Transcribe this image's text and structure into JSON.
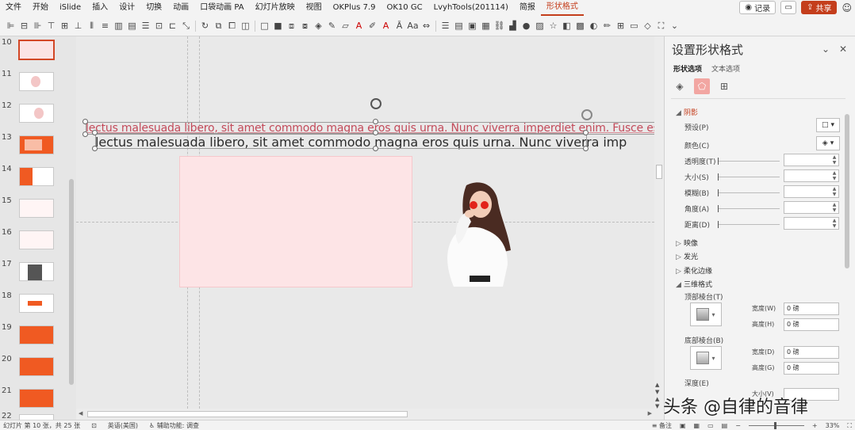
{
  "menubar": {
    "items": [
      "文件",
      "开始",
      "iSlide",
      "插入",
      "设计",
      "切换",
      "动画",
      "口袋动画 PA",
      "幻灯片放映",
      "视图",
      "OKPlus 7.9",
      "OK10 GC",
      "LvyhTools(201114)",
      "简报",
      "形状格式"
    ],
    "active": "形状格式",
    "record_label": "记录",
    "share_label": "共享"
  },
  "thumbnails": {
    "numbers": [
      "10",
      "11",
      "12",
      "13",
      "14",
      "15",
      "16",
      "17",
      "18",
      "19",
      "20",
      "21",
      "22"
    ],
    "selected": "10"
  },
  "slide": {
    "text_line1": "lectus malesuada libero, sit amet commodo magna eros quis urna. Nunc viverra imperdiet enim. Fusce est",
    "text_line2": "lectus malesuada libero, sit amet commodo magna eros quis urna. Nunc viverra imp"
  },
  "pane": {
    "title": "设置形状格式",
    "tabs": [
      "形状选项",
      "文本选项"
    ],
    "active_tab": "形状选项",
    "shadow_section": "阴影",
    "preset_label": "预设(P)",
    "color_label": "颜色(C)",
    "transparency_label": "透明度(T)",
    "size_label": "大小(S)",
    "blur_label": "模糊(B)",
    "angle_label": "角度(A)",
    "distance_label": "距离(D)",
    "reflection_section": "映像",
    "glow_section": "发光",
    "soft_edges_section": "柔化边缘",
    "format3d_section": "三维格式",
    "top_bevel_label": "顶部棱台(T)",
    "bottom_bevel_label": "底部棱台(B)",
    "width_w_label": "宽度(W)",
    "height_h_label": "高度(H)",
    "width_d_label": "宽度(D)",
    "height_g_label": "高度(G)",
    "depth_label": "深度(E)",
    "size_v_label": "大小(V)",
    "zero_value": "0 磅"
  },
  "status": {
    "slide_info": "幻灯片 第 10 张，共 25 张",
    "language": "英语(美国)",
    "accessibility": "辅助功能: 调查",
    "notes": "备注",
    "zoom": "33%"
  },
  "watermark": "头条 @自律的音律",
  "colors": {
    "accent": "#c43e1c",
    "pink_rect": "#fde4e6",
    "pink_text": "#c34a5a"
  }
}
